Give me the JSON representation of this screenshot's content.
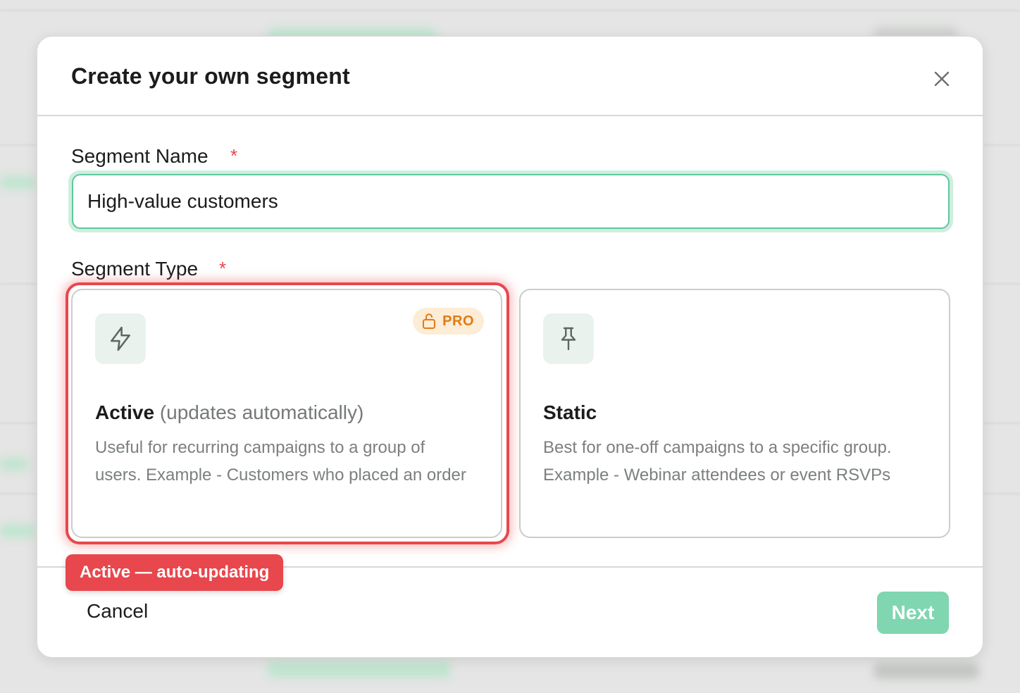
{
  "modal": {
    "title": "Create your own segment"
  },
  "segment_name": {
    "label": "Segment Name",
    "required_mark": "*",
    "value": "High-value customers"
  },
  "segment_type": {
    "label": "Segment Type",
    "required_mark": "*",
    "options": [
      {
        "title": "Active",
        "subtitle": "(updates automatically)",
        "description": "Useful for recurring campaigns to a group of users. Example - Customers who placed an order",
        "badge": "PRO",
        "icon": "lightning-icon",
        "selected": true
      },
      {
        "title": "Static",
        "subtitle": "",
        "description": "Best for one-off campaigns to a specific group. Example - Webinar attendees or event RSVPs",
        "icon": "pushpin-icon",
        "selected": false
      }
    ]
  },
  "annotation": {
    "label": "Active — auto-updating"
  },
  "footer": {
    "cancel_label": "Cancel",
    "next_label": "Next"
  },
  "colors": {
    "accent_green": "#5dc89d",
    "next_button": "#7fd6b0",
    "highlight_red": "#e8474d",
    "pro_badge_bg": "#fdecd6",
    "pro_badge_text": "#e07b16"
  }
}
